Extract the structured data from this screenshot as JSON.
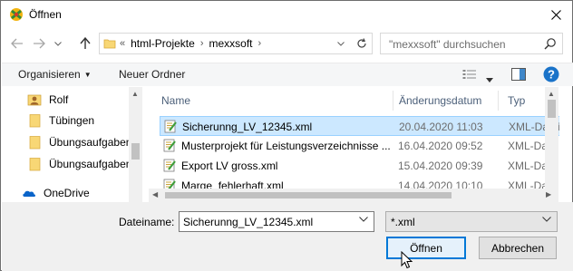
{
  "window": {
    "title": "Öffnen"
  },
  "address": {
    "overflow": "«",
    "crumbs": [
      "html-Projekte",
      "mexxsoft"
    ],
    "search_placeholder": "\"mexxsoft\" durchsuchen"
  },
  "toolbar": {
    "organize": "Organisieren",
    "new_folder": "Neuer Ordner"
  },
  "nav": {
    "items": [
      {
        "label": "Rolf",
        "icon": "user-folder-icon"
      },
      {
        "label": "Tübingen",
        "icon": "folder-icon"
      },
      {
        "label": "Übungsaufgaben",
        "icon": "folder-icon"
      },
      {
        "label": "Übungsaufgaben",
        "icon": "folder-icon"
      },
      {
        "label": "OneDrive",
        "icon": "onedrive-icon"
      }
    ]
  },
  "files": {
    "columns": {
      "name": "Name",
      "date": "Änderungsdatum",
      "type": "Typ"
    },
    "rows": [
      {
        "name": "Sicherunng_LV_12345.xml",
        "date": "20.04.2020 11:03",
        "type": "XML-Datei",
        "selected": true
      },
      {
        "name": "Musterprojekt für Leistungsverzeichnisse ...",
        "date": "16.04.2020 09:52",
        "type": "XML-Datei",
        "selected": false
      },
      {
        "name": "Export LV gross.xml",
        "date": "15.04.2020 09:39",
        "type": "XML-Datei",
        "selected": false
      },
      {
        "name": "Marge_fehlerhaft.xml",
        "date": "14.04.2020 10:10",
        "type": "XML-Datei",
        "selected": false
      }
    ]
  },
  "footer": {
    "filename_label": "Dateiname:",
    "filename_value": "Sicherunng_LV_12345.xml",
    "filetype": "*.xml",
    "open_label": "Öffnen",
    "cancel_label": "Abbrechen"
  },
  "colors": {
    "selection": "#cce8ff",
    "accent": "#0078d7",
    "help": "#1a73c9"
  }
}
